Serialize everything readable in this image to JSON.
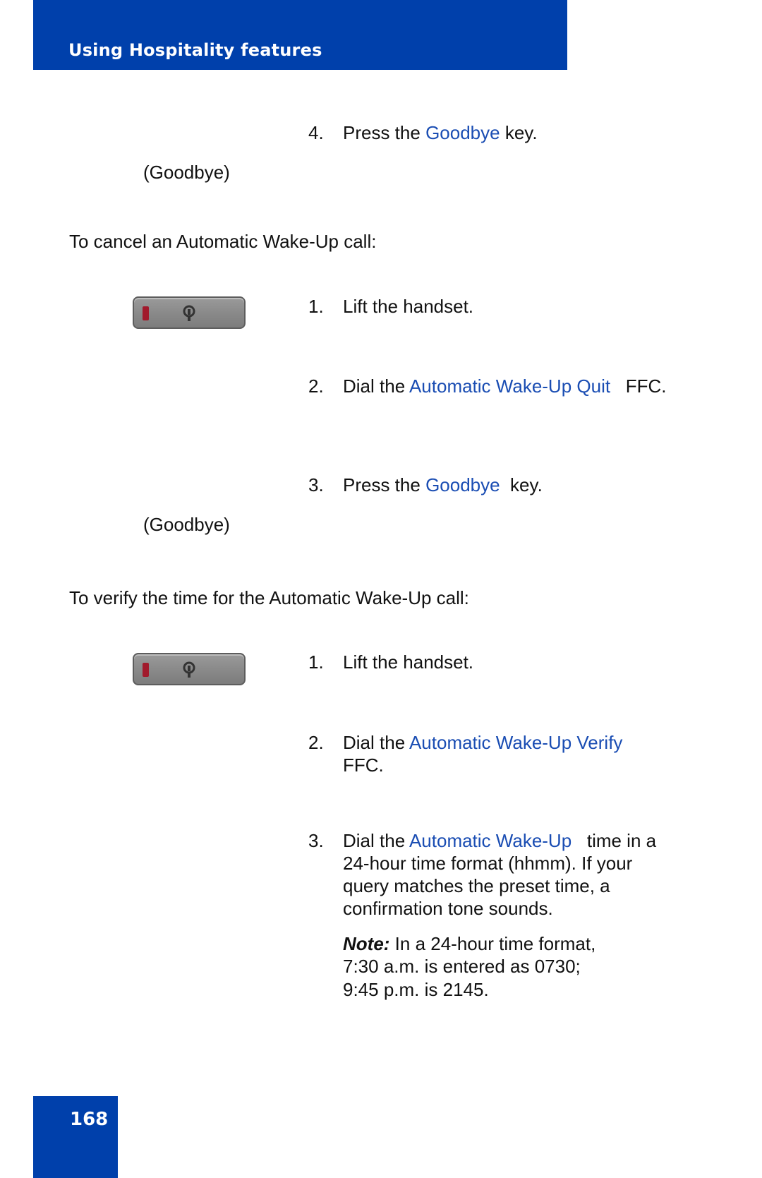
{
  "header": {
    "title": "Using Hospitality features"
  },
  "section1": {
    "step4": {
      "number": "4.",
      "pre": "Press the ",
      "link": "Goodbye",
      "post": "  key."
    },
    "goodbye_label": "(Goodbye)"
  },
  "section2": {
    "intro": "To cancel an Automatic Wake-Up call:",
    "step1": {
      "number": "1.",
      "text": "Lift the handset."
    },
    "step2": {
      "number": "2.",
      "pre": "Dial the ",
      "link": "Automatic Wake-Up Quit",
      "post": "   FFC."
    },
    "step3": {
      "number": "3.",
      "pre": "Press the ",
      "link": "Goodbye",
      "post": "  key."
    },
    "goodbye_label": "(Goodbye)"
  },
  "section3": {
    "intro": "To verify the time for the Automatic Wake-Up call:",
    "step1": {
      "number": "1.",
      "text": "Lift the handset."
    },
    "step2": {
      "number": "2.",
      "pre": "Dial the ",
      "link": "Automatic Wake-Up Verify",
      "line2": "FFC."
    },
    "step3": {
      "number": "3.",
      "pre": "Dial the ",
      "link": "Automatic Wake-Up",
      "post": "   time in a",
      "line2": "24-hour time format (hhmm). If your",
      "line3": "query matches the preset time, a",
      "line4": "confirmation tone sounds."
    },
    "note": {
      "label": "Note:",
      "line1": " In a 24-hour time format,",
      "line2": "7:30 a.m. is entered as 0730;",
      "line3": "9:45 p.m. is 2145."
    }
  },
  "icons": {
    "handset": "handset-key-icon"
  },
  "footer": {
    "page_number": "168"
  },
  "colors": {
    "brand_blue": "#0040ab",
    "link_blue": "#1a4db3"
  }
}
